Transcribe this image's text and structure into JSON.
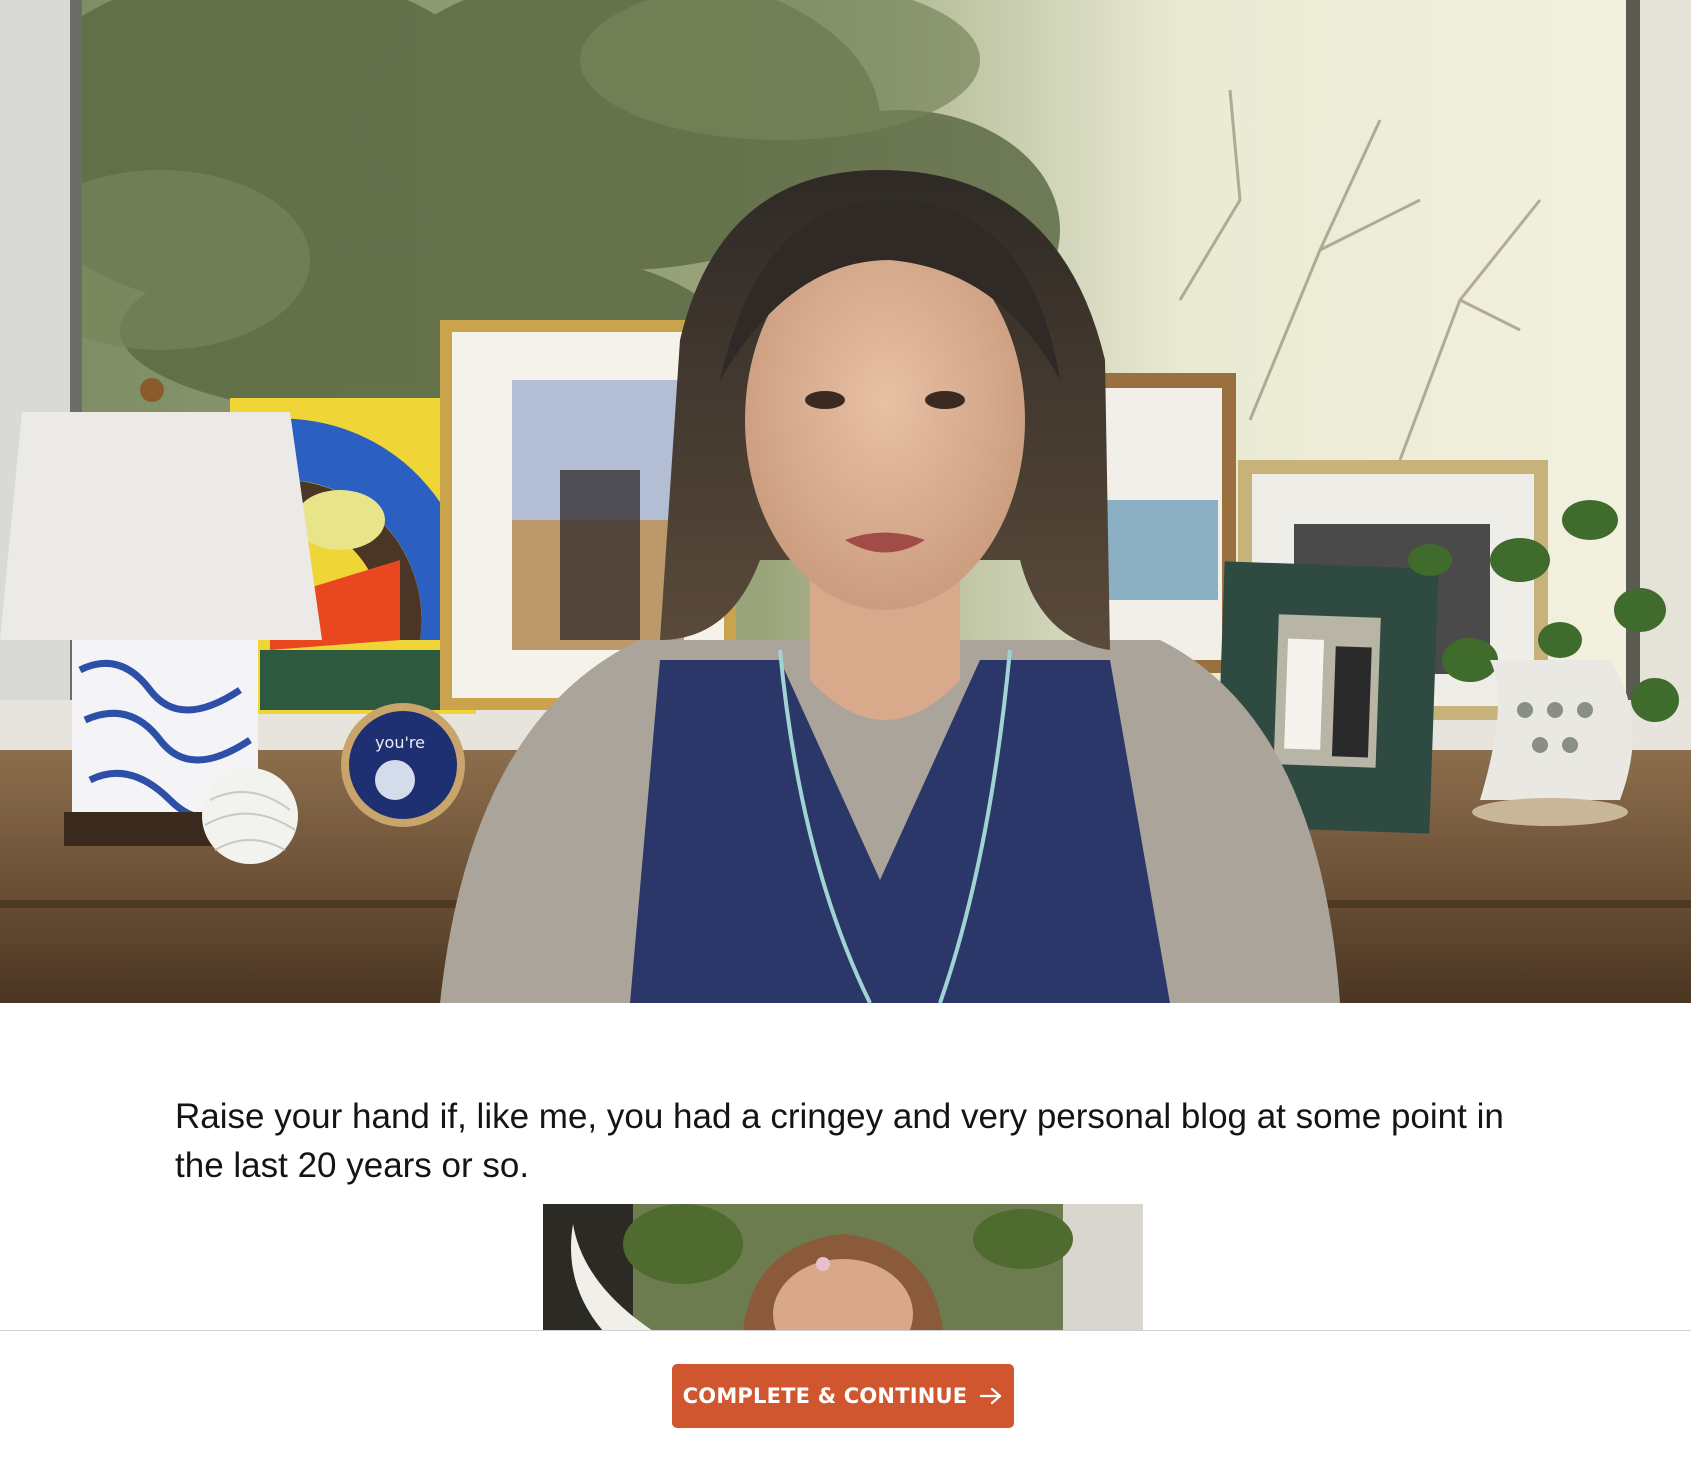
{
  "video": {
    "hoop_text": "you're"
  },
  "lesson": {
    "paragraph": "Raise your hand if, like me, you had a cringey and very personal blog at some point in the last 20 years or so."
  },
  "footer": {
    "complete_button_label": "COMPLETE & CONTINUE",
    "arrow_icon": "arrow-right-icon"
  },
  "colors": {
    "accent": "#d0562f",
    "divider": "#cfd3d6",
    "text": "#141414"
  }
}
